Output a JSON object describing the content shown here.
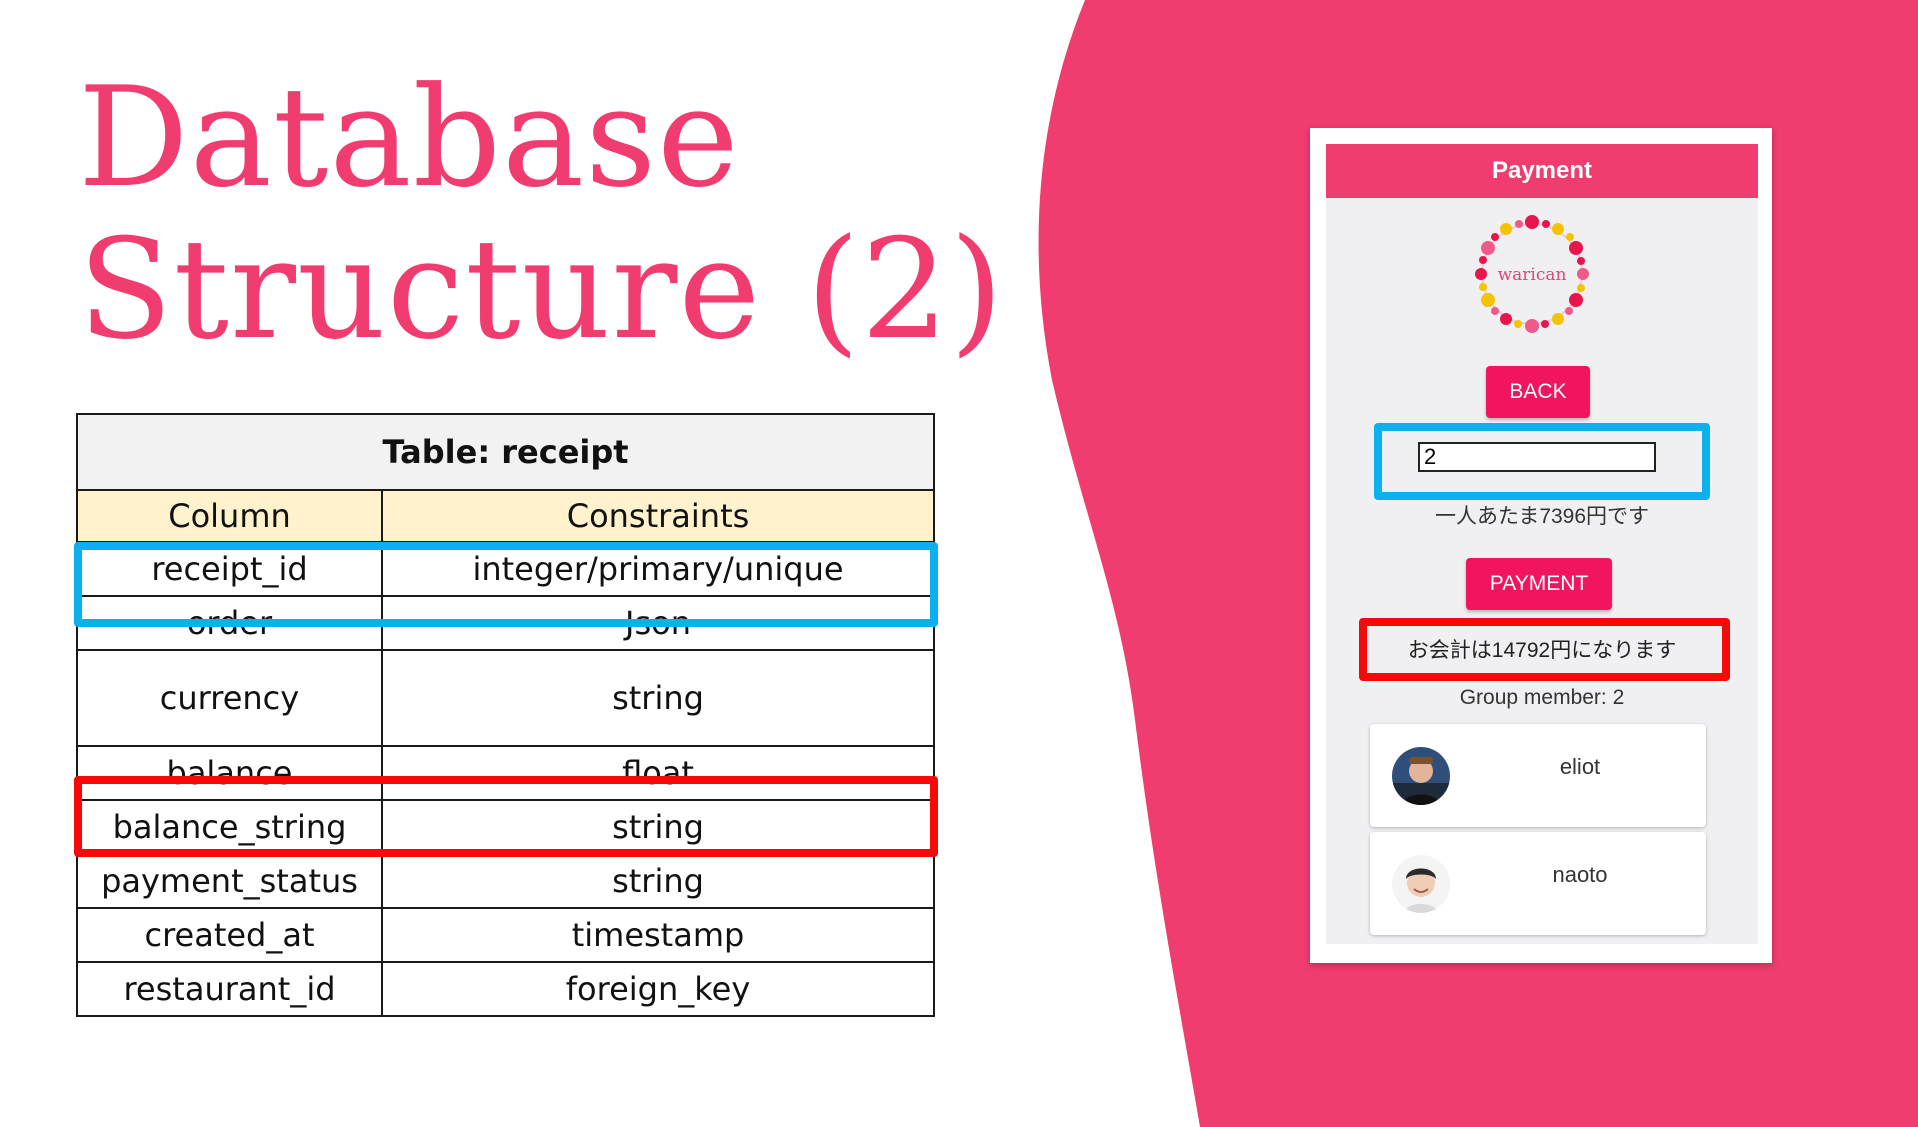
{
  "slide": {
    "title_line1": "Database",
    "title_line2": "Structure (2)",
    "accent_color": "#f03c6e"
  },
  "table": {
    "caption": "Table: receipt",
    "headers": [
      "Column",
      "Constraints"
    ],
    "rows": [
      {
        "column": "receipt_id",
        "constraint": "integer/primary/unique",
        "highlight": "blue"
      },
      {
        "column": "order",
        "constraint": "Json"
      },
      {
        "column": "currency",
        "constraint": "string"
      },
      {
        "column": "balance",
        "constraint": "float",
        "highlight": "red"
      },
      {
        "column": "balance_string",
        "constraint": "string"
      },
      {
        "column": "payment_status",
        "constraint": "string"
      },
      {
        "column": "created_at",
        "constraint": "timestamp"
      },
      {
        "column": "restaurant_id",
        "constraint": "foreign_key"
      }
    ]
  },
  "app": {
    "header_title": "Payment",
    "logo_text": "warican",
    "back_label": "BACK",
    "member_count_value": "2",
    "per_person_text": "一人あたま7396円です",
    "payment_label": "PAYMENT",
    "total_text": "お会計は14792円になります",
    "group_member_text": "Group member: 2",
    "members": [
      {
        "name": "eliot",
        "avatar": "avatar-icon"
      },
      {
        "name": "naoto",
        "avatar": "avatar-icon"
      }
    ],
    "colors": {
      "primary": "#f0155e",
      "header": "#f03c6e",
      "highlight_blue": "#0bb0ef",
      "highlight_red": "#f50a0a"
    }
  }
}
